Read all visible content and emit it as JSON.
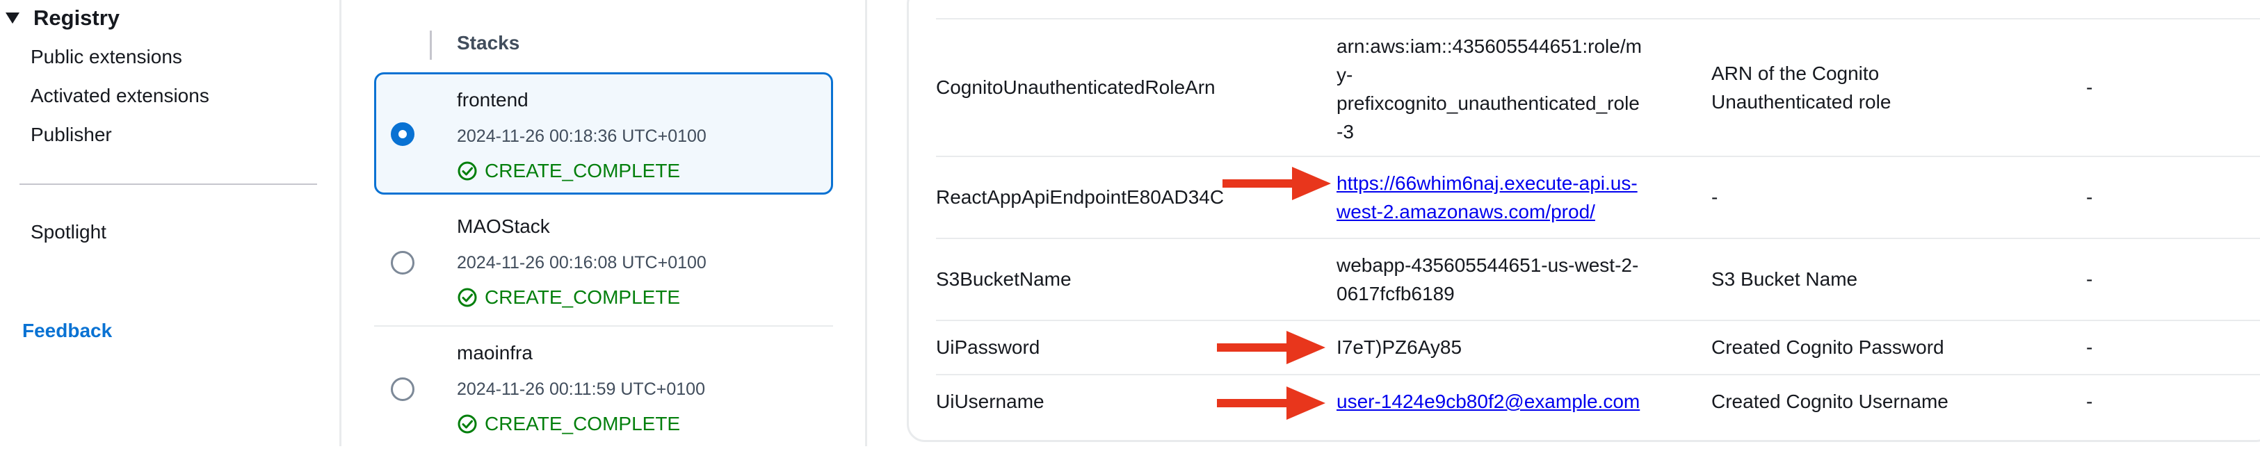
{
  "nav": {
    "section": "Registry",
    "items": [
      "Public extensions",
      "Activated extensions",
      "Publisher"
    ],
    "spotlight": "Spotlight",
    "feedback": "Feedback"
  },
  "stacks": {
    "header": "Stacks",
    "list": [
      {
        "name": "frontend",
        "time": "2024-11-26 00:18:36 UTC+0100",
        "status": "CREATE_COMPLETE",
        "selected": true
      },
      {
        "name": "MAOStack",
        "time": "2024-11-26 00:16:08 UTC+0100",
        "status": "CREATE_COMPLETE",
        "selected": false
      },
      {
        "name": "maoinfra",
        "time": "2024-11-26 00:11:59 UTC+0100",
        "status": "CREATE_COMPLETE",
        "selected": false
      }
    ]
  },
  "outputs": {
    "rows": [
      {
        "key": "CognitoUnauthenticatedRoleArn",
        "value_lines": [
          "arn:aws:iam::435605544651:role/m",
          "y-",
          "prefixcognito_unauthenticated_role",
          "-3"
        ],
        "description_lines": [
          "ARN of the Cognito",
          "Unauthenticated role"
        ],
        "export": "-"
      },
      {
        "key": "ReactAppApiEndpointE80AD34C",
        "value_lines": [
          "https://66whim6naj.execute-api.us-",
          "west-2.amazonaws.com/prod/"
        ],
        "description": "-",
        "export": "-"
      },
      {
        "key": "S3BucketName",
        "value_lines": [
          "webapp-435605544651-us-west-2-",
          "0617fcfb6189"
        ],
        "description": "S3 Bucket Name",
        "export": "-"
      },
      {
        "key": "UiPassword",
        "value": "I7eT)PZ6Ay85",
        "description": "Created Cognito Password",
        "export": "-"
      },
      {
        "key": "UiUsername",
        "value": "user-1424e9cb80f2@example.com",
        "description": "Created Cognito Username",
        "export": "-"
      }
    ]
  },
  "colors": {
    "accent": "#0972d3",
    "success": "#037f0c",
    "link": "#0000ee",
    "annotation_arrow": "#e8361c"
  },
  "icons": [
    "caret-down-icon",
    "radio-icon",
    "status-success-icon",
    "red-arrow-icon"
  ]
}
